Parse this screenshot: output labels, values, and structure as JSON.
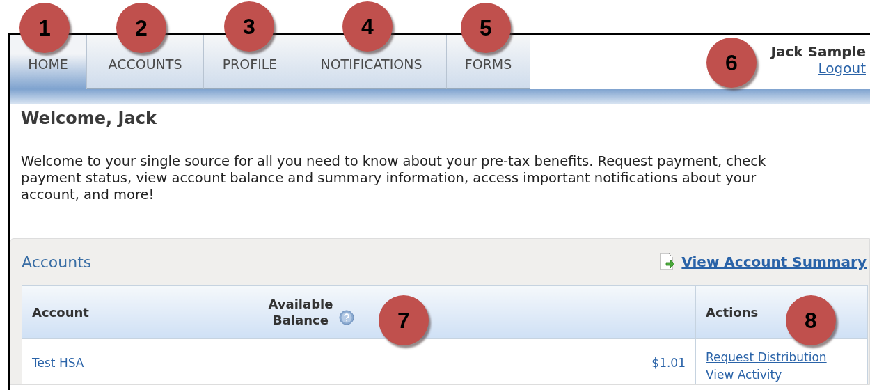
{
  "tabs": [
    {
      "label": "HOME",
      "selected": true
    },
    {
      "label": "ACCOUNTS",
      "selected": false
    },
    {
      "label": "PROFILE",
      "selected": false
    },
    {
      "label": "NOTIFICATIONS",
      "selected": false
    },
    {
      "label": "FORMS",
      "selected": false
    }
  ],
  "user": {
    "name": "Jack Sample",
    "logout": "Logout"
  },
  "welcome": {
    "title": "Welcome, Jack",
    "text": "Welcome to your single source for all you need to know about your pre-tax benefits. Request payment, check payment status, view account balance and summary information, access important notifications about your account, and more!"
  },
  "accounts": {
    "title": "Accounts",
    "summary_link": "View Account Summary",
    "columns": [
      "Account",
      "Available Balance",
      "Actions"
    ],
    "rows": [
      {
        "account": "Test HSA",
        "balance": "$1.01",
        "actions": [
          "Request Distribution",
          "View Activity"
        ]
      }
    ]
  },
  "callouts": [
    "1",
    "2",
    "3",
    "4",
    "5",
    "6",
    "7",
    "8"
  ]
}
